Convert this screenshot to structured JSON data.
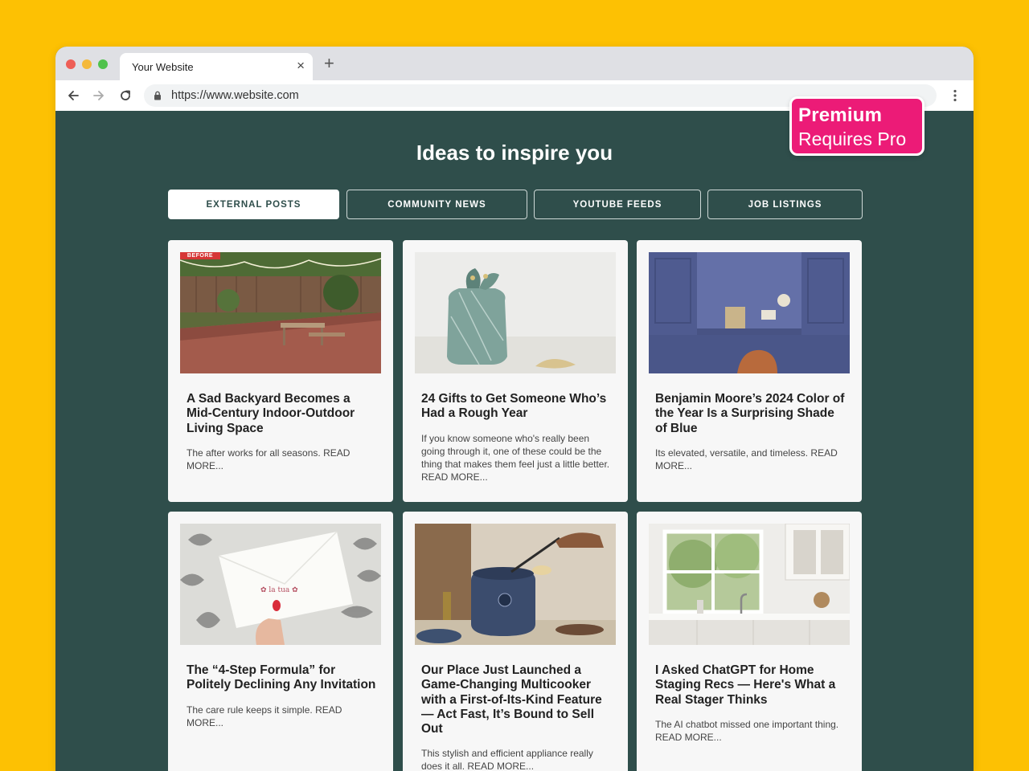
{
  "browser": {
    "tab_title": "Your Website",
    "tab_close": "×",
    "new_tab": "+",
    "url": "https://www.website.com",
    "icons": [
      "back-arrow-icon",
      "forward-arrow-icon",
      "reload-icon",
      "lock-icon",
      "more-vertical-icon"
    ]
  },
  "premium": {
    "title": "Premium",
    "subtitle": "Requires Pro",
    "color": "#ec1b77"
  },
  "page": {
    "headline": "Ideas to inspire you",
    "filters": [
      "EXTERNAL POSTS",
      "COMMUNITY NEWS",
      "YOUTUBE FEEDS",
      "JOB LISTINGS"
    ],
    "active_filter": "EXTERNAL POSTS"
  },
  "colors": {
    "background": "#fdc103",
    "page_bg": "#2f4e4b",
    "card_bg": "#f7f7f7"
  },
  "cards": [
    {
      "title": "A Sad Backyard Becomes a Mid-Century Indoor-Outdoor Living Space",
      "description": "The after works for all seasons. READ MORE...",
      "image": "backyard-patio-photo",
      "badge": "BEFORE"
    },
    {
      "title": "24 Gifts to Get Someone Who’s Had a Rough Year",
      "description": "If you know someone who's really been going through it, one of these could be the thing that makes them feel just a little better. READ MORE...",
      "image": "wrapped-gift-photo"
    },
    {
      "title": "Benjamin Moore’s 2024 Color of the Year Is a Surprising Shade of Blue",
      "description": "Its elevated, versatile, and timeless. READ MORE...",
      "image": "blue-cabinet-office-photo"
    },
    {
      "title": "The “4-Step Formula” for Politely Declining Any Invitation",
      "description": "The care rule keeps it simple. READ MORE...",
      "image": "envelope-in-hand-photo"
    },
    {
      "title": "Our Place Just Launched a Game-Changing Multicooker with a First-of-Its-Kind Feature — Act Fast, It’s Bound to Sell Out",
      "description": "This stylish and efficient appliance really does it all. READ MORE...",
      "image": "multicooker-kitchen-photo"
    },
    {
      "title": "I Asked ChatGPT for Home Staging Recs — Here's What a Real Stager Thinks",
      "description": "The AI chatbot missed one important thing. READ MORE...",
      "image": "white-kitchen-window-photo"
    }
  ]
}
